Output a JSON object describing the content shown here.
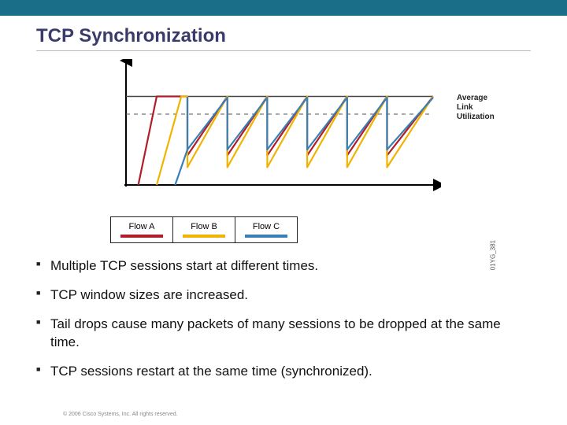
{
  "header": {
    "title": "TCP Synchronization"
  },
  "chart_data": {
    "type": "line",
    "title": "",
    "xlabel": "",
    "ylabel": "",
    "xlim": [
      0,
      100
    ],
    "ylim": [
      0,
      100
    ],
    "annotation": "Average\nLink\nUtilization",
    "threshold_y": 75,
    "avg_util_y": 60,
    "series": [
      {
        "name": "Flow A",
        "color": "#b11e2a",
        "values": [
          [
            4,
            0
          ],
          [
            10,
            75
          ],
          [
            20,
            75
          ],
          [
            20,
            25
          ],
          [
            33,
            75
          ],
          [
            33,
            25
          ],
          [
            46,
            75
          ],
          [
            46,
            25
          ],
          [
            59,
            75
          ],
          [
            59,
            25
          ],
          [
            72,
            75
          ],
          [
            72,
            25
          ],
          [
            85,
            75
          ],
          [
            85,
            25
          ],
          [
            100,
            75
          ]
        ]
      },
      {
        "name": "Flow B",
        "color": "#f0b400",
        "values": [
          [
            10,
            0
          ],
          [
            18,
            75
          ],
          [
            20,
            75
          ],
          [
            20,
            15
          ],
          [
            33,
            75
          ],
          [
            33,
            15
          ],
          [
            46,
            75
          ],
          [
            46,
            15
          ],
          [
            59,
            75
          ],
          [
            59,
            15
          ],
          [
            72,
            75
          ],
          [
            72,
            15
          ],
          [
            85,
            75
          ],
          [
            85,
            15
          ],
          [
            100,
            75
          ]
        ]
      },
      {
        "name": "Flow C",
        "color": "#3a7fb5",
        "values": [
          [
            16,
            0
          ],
          [
            20,
            30
          ],
          [
            20,
            74
          ],
          [
            20,
            30
          ],
          [
            33,
            74
          ],
          [
            33,
            30
          ],
          [
            46,
            74
          ],
          [
            46,
            30
          ],
          [
            59,
            74
          ],
          [
            59,
            30
          ],
          [
            72,
            74
          ],
          [
            72,
            30
          ],
          [
            85,
            74
          ],
          [
            85,
            30
          ],
          [
            100,
            74
          ]
        ]
      }
    ],
    "ref_code": "01YG_381"
  },
  "legend": {
    "items": [
      {
        "label": "Flow A",
        "color": "#b11e2a"
      },
      {
        "label": "Flow B",
        "color": "#f0b400"
      },
      {
        "label": "Flow C",
        "color": "#3a7fb5"
      }
    ]
  },
  "bullets": [
    "Multiple TCP sessions start at different times.",
    "TCP window sizes are increased.",
    "Tail drops cause many packets of many sessions to be dropped at the same time.",
    "TCP sessions restart at the same time (synchronized)."
  ],
  "footer": {
    "copyright": "© 2006 Cisco Systems, Inc. All rights reserved."
  }
}
